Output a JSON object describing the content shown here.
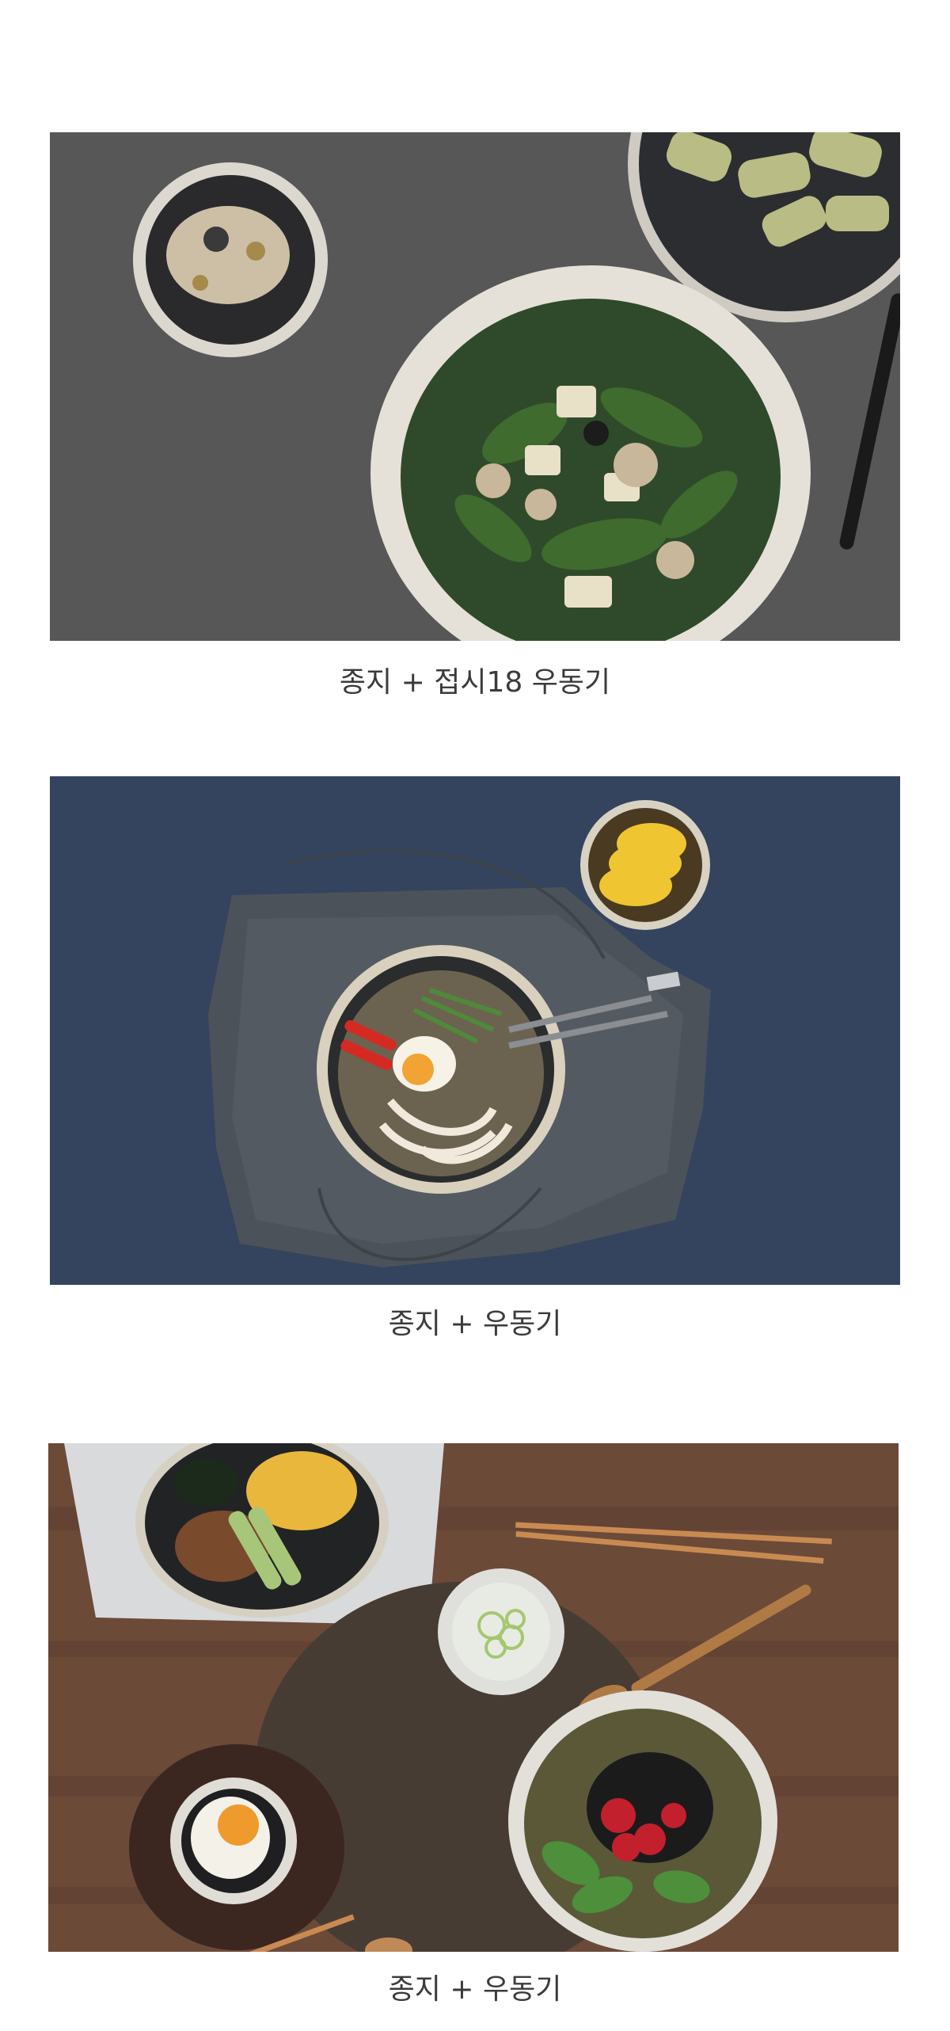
{
  "sections": [
    {
      "caption": "종지 + 접시18 우동기",
      "photo_icon": "salad-bowl-photo",
      "background": "#5a5a5c"
    },
    {
      "caption": "종지 + 우동기",
      "photo_icon": "udon-bowl-photo",
      "background": "#34435e"
    },
    {
      "caption": "종지 +  우동기",
      "photo_icon": "bibimbap-table-photo",
      "background": "#6b4a38"
    }
  ]
}
